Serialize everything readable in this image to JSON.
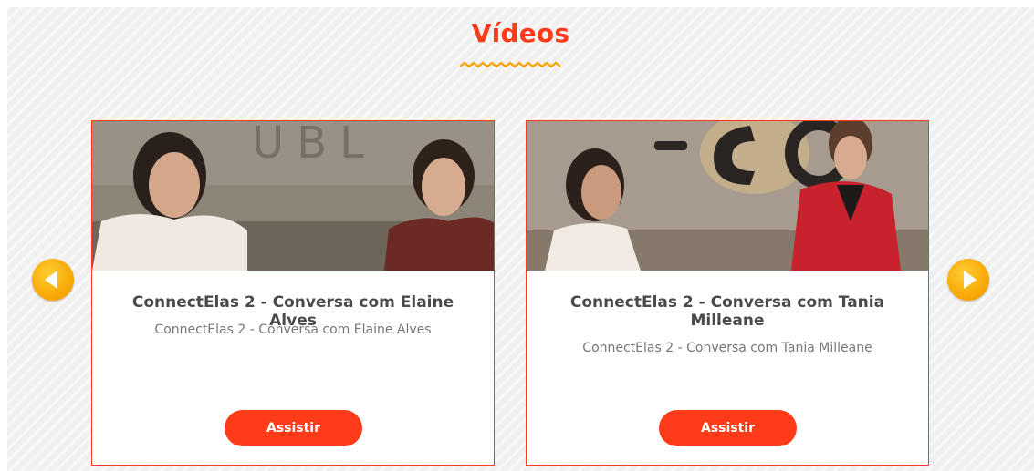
{
  "section": {
    "title": "Vídeos",
    "accent_color": "#ff3b1a",
    "zigzag_color": "#f7a400"
  },
  "carousel": {
    "prev_icon": "chevron-left-icon",
    "next_icon": "chevron-right-icon",
    "cards": [
      {
        "title": "ConnectElas 2 - Conversa com Elaine Alves",
        "description": "ConnectElas 2 - Conversa com Elaine Alves",
        "button_label": "Assistir"
      },
      {
        "title": "ConnectElas 2 - Conversa com Tania Milleane",
        "description": "ConnectElas 2 - Conversa com Tania Milleane",
        "button_label": "Assistir"
      }
    ]
  }
}
